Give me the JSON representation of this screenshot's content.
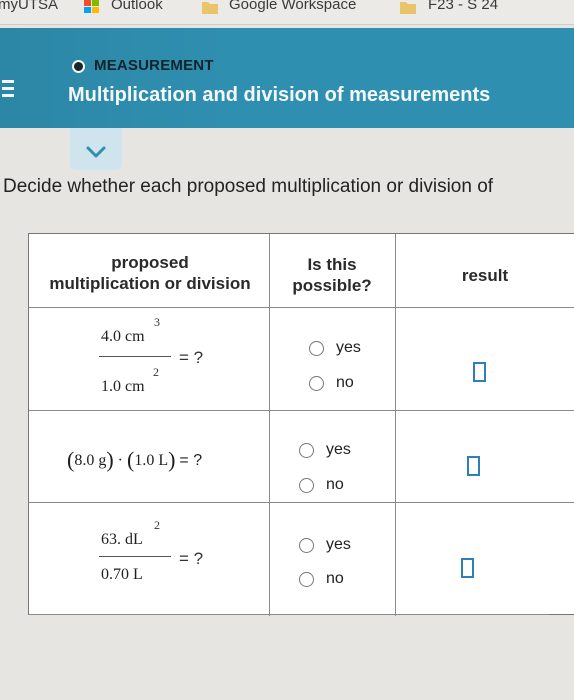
{
  "bookmarks": [
    {
      "label": "myUTSA"
    },
    {
      "label": "Outlook"
    },
    {
      "label": "Google Workspace"
    },
    {
      "label": "F23 - S 24"
    }
  ],
  "header": {
    "topic": "MEASUREMENT",
    "title": "Multiplication and division of measurements"
  },
  "instructions": "Decide whether each proposed multiplication or division of",
  "table": {
    "headers": {
      "col1_line1": "proposed",
      "col1_line2": "multiplication or division",
      "col2_line1": "Is this",
      "col2_line2": "possible?",
      "col3": "result"
    },
    "rows": [
      {
        "numerator": "4.0 cm",
        "numerator_exp": "3",
        "denominator": "1.0 cm",
        "denominator_exp": "2",
        "equals": "= ?",
        "yes": "yes",
        "no": "no"
      },
      {
        "product": "(8.0 g)·(1.0 L) = ?",
        "p1": "8.0 g",
        "p2": "1.0 L",
        "dot": "·",
        "equals": "= ?",
        "yes": "yes",
        "no": "no"
      },
      {
        "numerator": "63. dL",
        "numerator_exp": "2",
        "denominator": "0.70 L",
        "equals": "= ?",
        "yes": "yes",
        "no": "no"
      }
    ]
  },
  "colors": {
    "header": "#2f8fb0",
    "result_box": "#2d7fb8"
  }
}
